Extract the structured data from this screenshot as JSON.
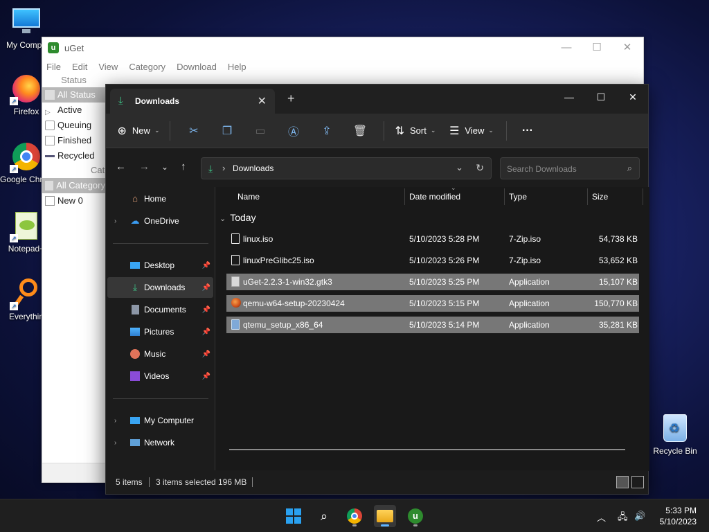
{
  "desktop": {
    "icons": [
      {
        "label": "My Compu"
      },
      {
        "label": "Firefox"
      },
      {
        "label": "Google Chrome"
      },
      {
        "label": "Notepad+"
      },
      {
        "label": "Everythin"
      }
    ],
    "recycle_bin": "Recycle Bin"
  },
  "uget": {
    "title": "uGet",
    "menu": [
      "File",
      "Edit",
      "View",
      "Category",
      "Download",
      "Help"
    ],
    "status_header": "Status",
    "status_items": [
      "All Status",
      "Active",
      "Queuing",
      "Finished",
      "Recycled"
    ],
    "category_header": "Cate",
    "category_items": [
      "All Category",
      "New 0"
    ]
  },
  "explorer": {
    "tab_title": "Downloads",
    "commands": {
      "new": "New",
      "sort": "Sort",
      "view": "View"
    },
    "address": {
      "path": "Downloads"
    },
    "search": {
      "placeholder": "Search Downloads"
    },
    "nav": {
      "home": "Home",
      "onedrive": "OneDrive",
      "desktop": "Desktop",
      "downloads": "Downloads",
      "documents": "Documents",
      "pictures": "Pictures",
      "music": "Music",
      "videos": "Videos",
      "my_computer": "My Computer",
      "network": "Network"
    },
    "columns": {
      "name": "Name",
      "date": "Date modified",
      "type": "Type",
      "size": "Size"
    },
    "group": "Today",
    "files": [
      {
        "name": "linux.iso",
        "date": "5/10/2023 5:28 PM",
        "type": "7-Zip.iso",
        "size": "54,738 KB",
        "selected": false
      },
      {
        "name": "linuxPreGlibc25.iso",
        "date": "5/10/2023 5:26 PM",
        "type": "7-Zip.iso",
        "size": "53,652 KB",
        "selected": false
      },
      {
        "name": "uGet-2.2.3-1-win32.gtk3",
        "date": "5/10/2023 5:25 PM",
        "type": "Application",
        "size": "15,107 KB",
        "selected": true
      },
      {
        "name": "qemu-w64-setup-20230424",
        "date": "5/10/2023 5:15 PM",
        "type": "Application",
        "size": "150,770 KB",
        "selected": true
      },
      {
        "name": "qtemu_setup_x86_64",
        "date": "5/10/2023 5:14 PM",
        "type": "Application",
        "size": "35,281 KB",
        "selected": true
      }
    ],
    "status": {
      "items": "5 items",
      "selected": "3 items selected",
      "size": "196 MB"
    }
  },
  "taskbar": {
    "time": "5:33 PM",
    "date": "5/10/2023"
  }
}
